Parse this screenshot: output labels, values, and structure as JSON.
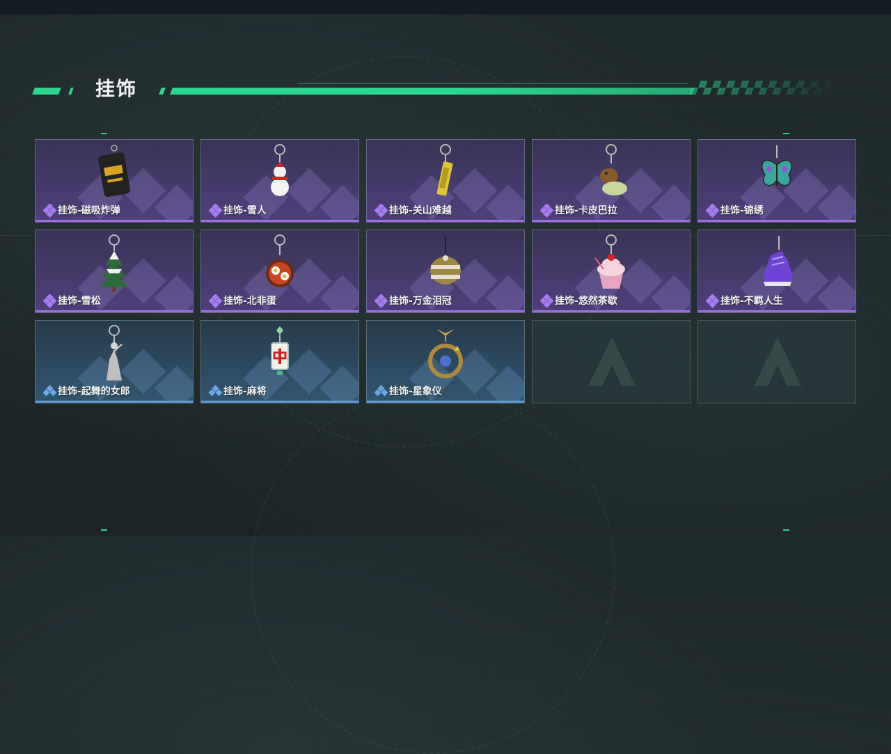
{
  "section": {
    "title": "挂饰"
  },
  "colors": {
    "accent": "#2ed58f",
    "epic": "#9b6ee0",
    "rare": "#5e9ad6"
  },
  "items": [
    {
      "label": "挂饰-磁吸炸弹",
      "rarity": "epic",
      "icon": "bomb-charm-icon",
      "empty": false
    },
    {
      "label": "挂饰-雪人",
      "rarity": "epic",
      "icon": "snowman-charm-icon",
      "empty": false
    },
    {
      "label": "挂饰-关山难越",
      "rarity": "epic",
      "icon": "gold-bar-charm-icon",
      "empty": false
    },
    {
      "label": "挂饰-卡皮巴拉",
      "rarity": "epic",
      "icon": "capybara-charm-icon",
      "empty": false
    },
    {
      "label": "挂饰-锦绣",
      "rarity": "epic",
      "icon": "butterfly-charm-icon",
      "empty": false
    },
    {
      "label": "挂饰-雪松",
      "rarity": "epic",
      "icon": "pine-tree-charm-icon",
      "empty": false
    },
    {
      "label": "挂饰-北非蛋",
      "rarity": "epic",
      "icon": "shakshuka-charm-icon",
      "empty": false
    },
    {
      "label": "挂饰-万金泪冠",
      "rarity": "epic",
      "icon": "crown-charm-icon",
      "empty": false
    },
    {
      "label": "挂饰-悠然茶歇",
      "rarity": "epic",
      "icon": "cupcake-charm-icon",
      "empty": false
    },
    {
      "label": "挂饰-不羁人生",
      "rarity": "epic",
      "icon": "sneaker-charm-icon",
      "empty": false
    },
    {
      "label": "挂饰-起舞的女郎",
      "rarity": "rare",
      "icon": "dancer-charm-icon",
      "empty": false
    },
    {
      "label": "挂饰-麻将",
      "rarity": "rare",
      "icon": "mahjong-charm-icon",
      "empty": false
    },
    {
      "label": "挂饰-星象仪",
      "rarity": "rare",
      "icon": "astrolabe-charm-icon",
      "empty": false
    },
    {
      "label": "",
      "rarity": "none",
      "icon": "empty-slot-logo-icon",
      "empty": true
    },
    {
      "label": "",
      "rarity": "none",
      "icon": "empty-slot-logo-icon",
      "empty": true
    }
  ]
}
